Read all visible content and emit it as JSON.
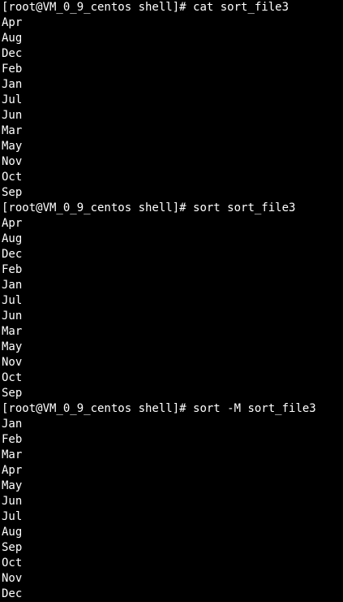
{
  "terminal": {
    "background": "#000000",
    "foreground": "#ffffff",
    "blocks": [
      {
        "prompt": "[root@VM_0_9_centos shell]# ",
        "command": "cat sort_file3",
        "output": [
          "Apr",
          "Aug",
          "Dec",
          "Feb",
          "Jan",
          "Jul",
          "Jun",
          "Mar",
          "May",
          "Nov",
          "Oct",
          "Sep"
        ]
      },
      {
        "prompt": "[root@VM_0_9_centos shell]# ",
        "command": "sort sort_file3",
        "output": [
          "Apr",
          "Aug",
          "Dec",
          "Feb",
          "Jan",
          "Jul",
          "Jun",
          "Mar",
          "May",
          "Nov",
          "Oct",
          "Sep"
        ]
      },
      {
        "prompt": "[root@VM_0_9_centos shell]# ",
        "command": "sort -M sort_file3",
        "output": [
          "Jan",
          "Feb",
          "Mar",
          "Apr",
          "May",
          "Jun",
          "Jul",
          "Aug",
          "Sep",
          "Oct",
          "Nov",
          "Dec"
        ]
      }
    ]
  }
}
